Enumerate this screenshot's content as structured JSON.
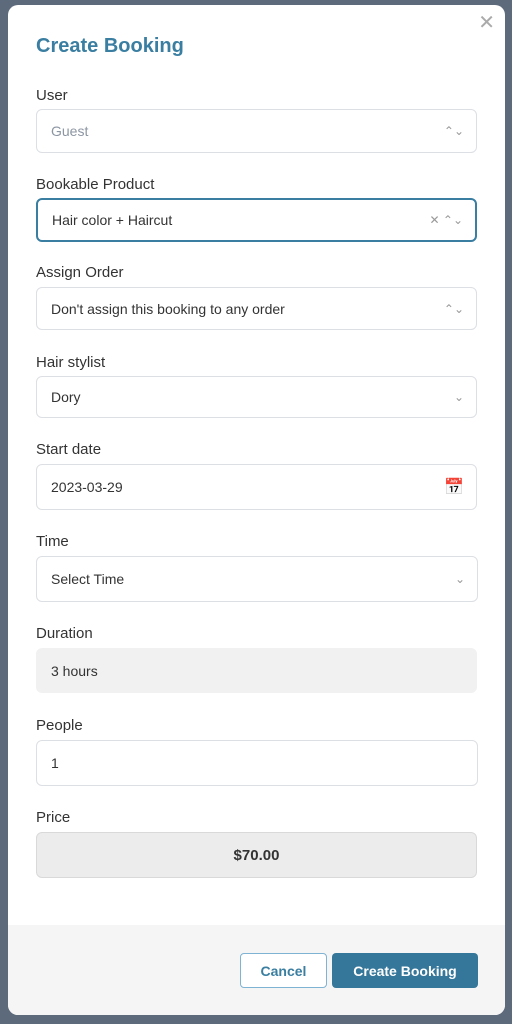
{
  "modal": {
    "title": "Create Booking",
    "close_icon": "close-icon"
  },
  "fields": {
    "user": {
      "label": "User",
      "placeholder": "Guest"
    },
    "product": {
      "label": "Bookable Product",
      "value": "Hair color + Haircut"
    },
    "order": {
      "label": "Assign Order",
      "value": "Don't assign this booking to any order"
    },
    "stylist": {
      "label": "Hair stylist",
      "value": "Dory"
    },
    "start_date": {
      "label": "Start date",
      "value": "2023-03-29"
    },
    "time": {
      "label": "Time",
      "value": "Select Time"
    },
    "duration": {
      "label": "Duration",
      "value": "3 hours"
    },
    "people": {
      "label": "People",
      "value": "1"
    },
    "price": {
      "label": "Price",
      "value": "$70.00"
    }
  },
  "footer": {
    "cancel": "Cancel",
    "create": "Create Booking"
  },
  "colors": {
    "accent": "#3a7ea1",
    "button": "#35779a"
  }
}
